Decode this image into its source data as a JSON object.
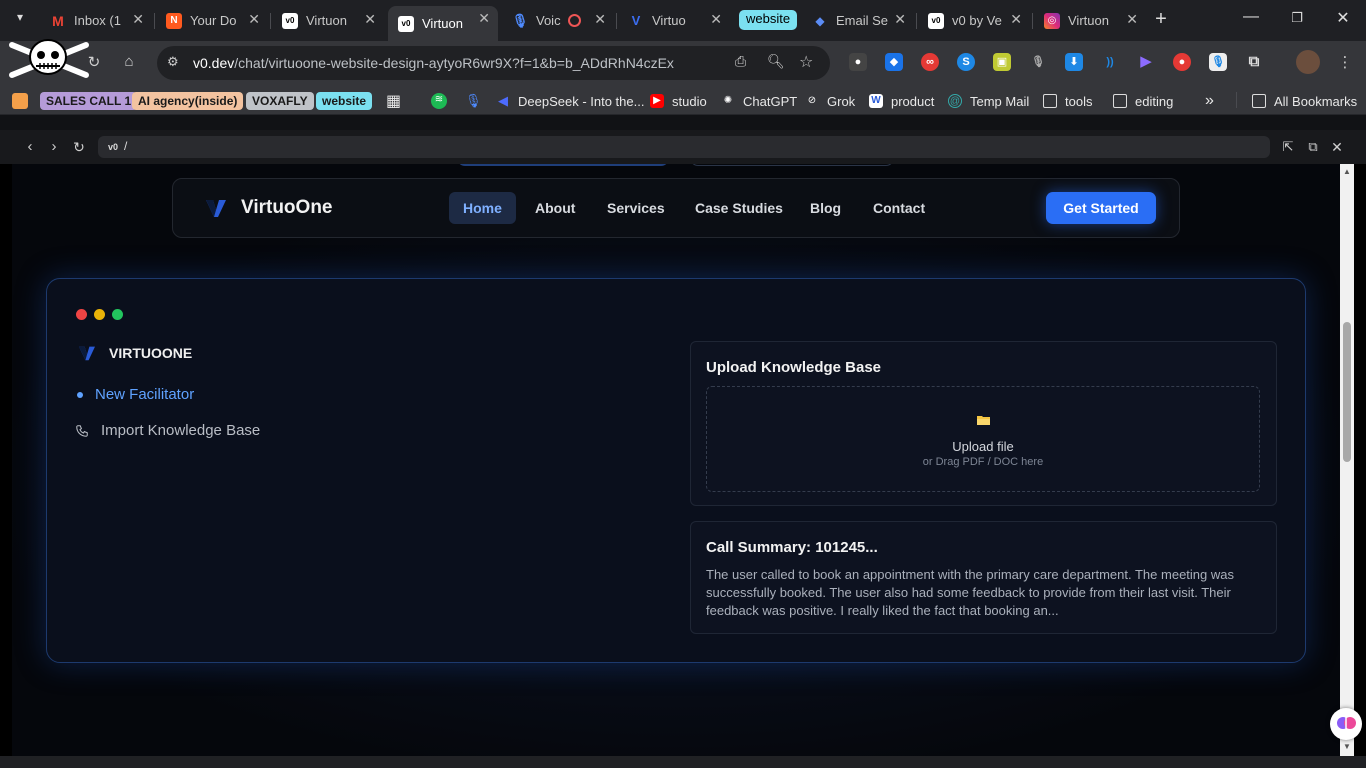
{
  "browser": {
    "tabs": [
      {
        "title": "Inbox (1",
        "icon": "gmail-icon",
        "color": "#ea4335"
      },
      {
        "title": "Your Do",
        "icon": "app-icon",
        "color": "#ff5a1f"
      },
      {
        "title": "Virtuon",
        "icon": "v0-icon",
        "color": "#ffffff"
      },
      {
        "title": "Virtuon",
        "icon": "v0-icon",
        "color": "#ffffff",
        "active": true
      },
      {
        "title": "Voic",
        "icon": "mic-icon",
        "color": "#4f8bff"
      },
      {
        "title": "Virtuo",
        "icon": "virtuoone-icon",
        "color": "#3b6df0"
      },
      {
        "title": "website",
        "icon": "group-chip",
        "color": "#7be0f0"
      },
      {
        "title": "Email Se",
        "icon": "email-icon",
        "color": "#5b8cf5"
      },
      {
        "title": "v0 by Ve",
        "icon": "v0-icon",
        "color": "#ffffff"
      },
      {
        "title": "Virtuon",
        "icon": "instagram-icon",
        "color": "#e1306c"
      }
    ],
    "url_host": "v0.dev",
    "url_path": "/chat/virtuoone-website-design-aytyoR6wr9X?f=1&b=b_ADdRhN4czEx",
    "bookmarks": {
      "chip1": "SALES CALL 1",
      "chip2": "AI agency(inside)",
      "chip3": "VOXAFLY",
      "chip4": "website",
      "b1": "DeepSeek - Into the...",
      "b2": "studio",
      "b3": "ChatGPT",
      "b4": "Grok",
      "b5": "product",
      "b6": "Temp Mail",
      "b7": "tools",
      "b8": "editing",
      "more": "»",
      "all": "All Bookmarks"
    },
    "preview_url": "/"
  },
  "site": {
    "brand": "VirtuoOne",
    "nav": [
      "Home",
      "About",
      "Services",
      "Case Studies",
      "Blog",
      "Contact"
    ],
    "cta": "Get Started",
    "accent": "#2a6ef5"
  },
  "card": {
    "brand": "VIRTUOONE",
    "menu": [
      "New Facilitator",
      "Import Knowledge Base"
    ],
    "upload": {
      "title": "Upload Knowledge Base",
      "label": "Upload file",
      "hint": "or Drag PDF / DOC here"
    },
    "summary": {
      "title": "Call Summary: 101245...",
      "text": "The user called to book an appointment with the primary care department. The meeting was successfully booked. The user also had some feedback to provide from their last visit. Their feedback was positive. I really liked the fact that booking an..."
    }
  }
}
